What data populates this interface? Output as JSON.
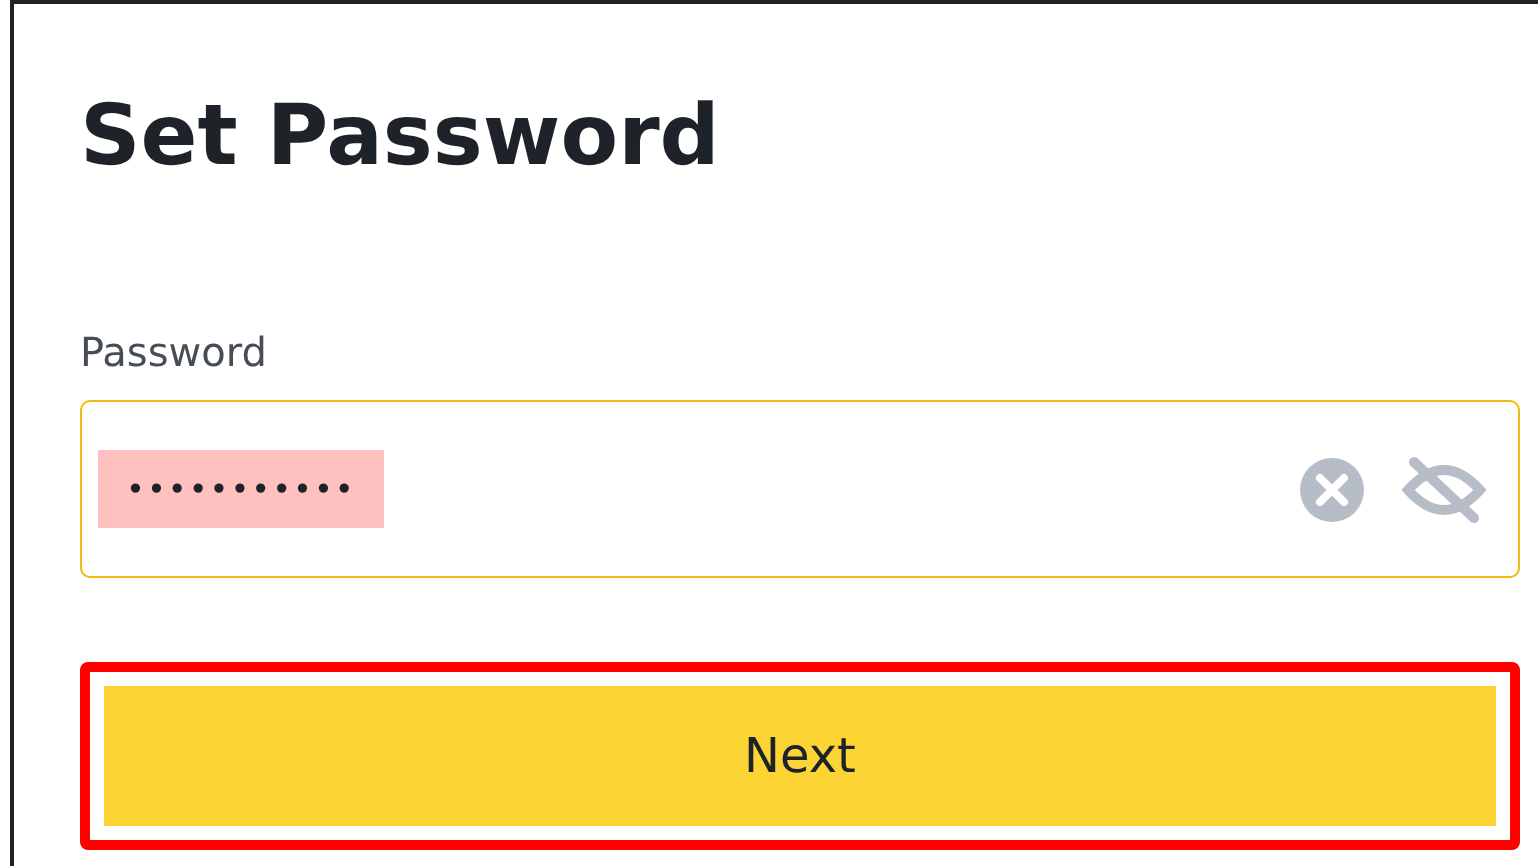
{
  "title": "Set Password",
  "password": {
    "label": "Password",
    "value": "•••••••••••",
    "highlighted": true
  },
  "next_button": {
    "label": "Next",
    "highlighted": true
  }
}
